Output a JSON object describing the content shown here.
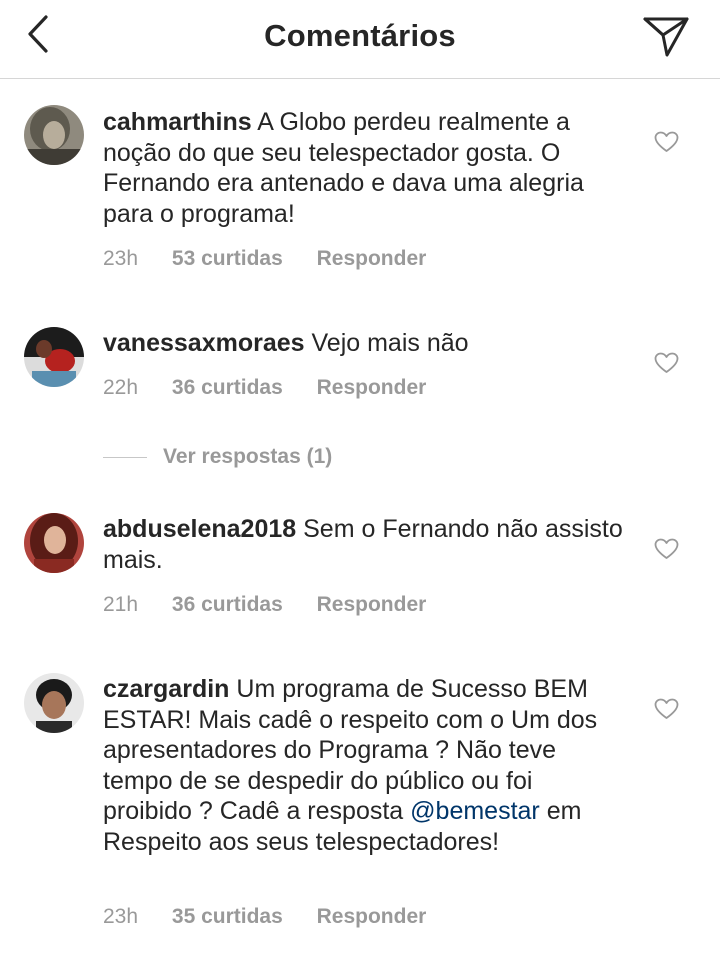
{
  "header": {
    "title": "Comentários",
    "back_icon": "chevron-left-icon",
    "send_icon": "paper-plane-icon"
  },
  "comments": [
    {
      "username": "cahmarthins",
      "text": "A Globo perdeu realmente a noção do que seu telespectador gosta. O Fernando era antenado e dava uma alegria para o programa!",
      "time": "23h",
      "likes": "53 curtidas",
      "reply": "Responder"
    },
    {
      "username": "vanessaxmoraes",
      "text": "Vejo mais não",
      "time": "22h",
      "likes": "36 curtidas",
      "reply": "Responder",
      "view_replies": "Ver respostas (1)"
    },
    {
      "username": "abduselena2018",
      "text": "Sem o Fernando não assisto mais.",
      "time": "21h",
      "likes": "36 curtidas",
      "reply": "Responder"
    },
    {
      "username": "czargardin",
      "text_before": "Um programa de Sucesso BEM ESTAR! Mais cadê o respeito com o Um dos apresentadores do Programa ? Não teve tempo de se despedir do público ou foi proibido ? Cadê a resposta",
      "mention": "@bemestar",
      "text_after": "em Respeito aos seus telespectadores!",
      "time": "23h",
      "likes": "35 curtidas",
      "reply": "Responder"
    }
  ],
  "colors": {
    "text": "#262626",
    "meta": "#999999",
    "mention": "#003569",
    "divider": "#d6d6d6"
  }
}
